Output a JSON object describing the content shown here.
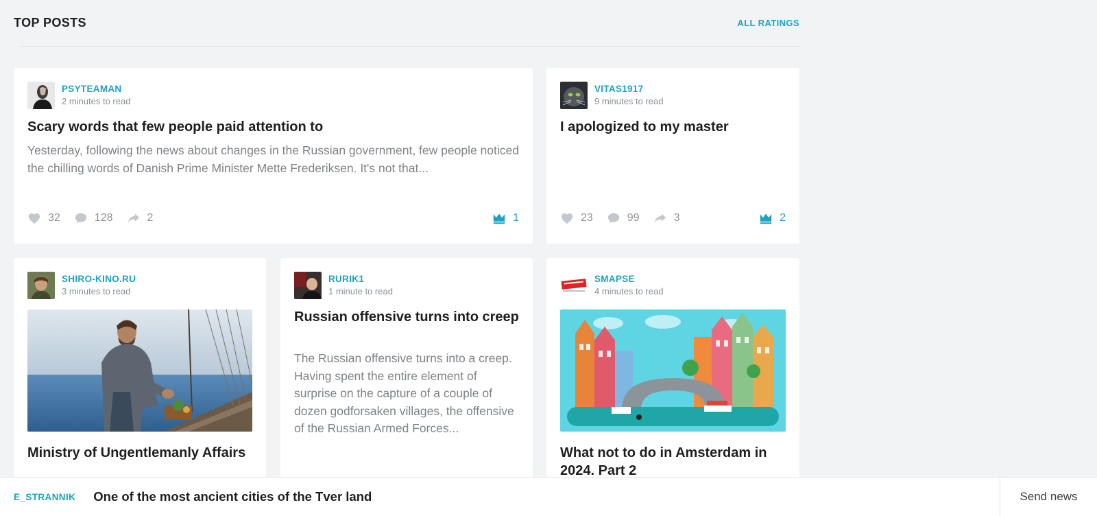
{
  "header": {
    "title": "TOP POSTS",
    "all_ratings": "ALL RATINGS"
  },
  "colors": {
    "accent": "#1aa3c2",
    "muted": "#8e9297",
    "background": "#f2f3f4"
  },
  "posts": [
    {
      "author": "PSYTEAMAN",
      "read_time": "2 minutes to read",
      "title": "Scary words that few people paid attention to",
      "excerpt": "Yesterday, following the news about changes in the Russian government, few people noticed the chilling words of Danish Prime Minister Mette Frederiksen. It's not that...",
      "likes": "32",
      "comments": "128",
      "shares": "2",
      "rating": "1"
    },
    {
      "author": "VITAS1917",
      "read_time": "9 minutes to read",
      "title": "I apologized to my master",
      "likes": "23",
      "comments": "99",
      "shares": "3",
      "rating": "2"
    },
    {
      "author": "SHIRO-KINO.RU",
      "read_time": "3 minutes to read",
      "title": "Ministry of Ungentlemanly Affairs"
    },
    {
      "author": "RURIK1",
      "read_time": "1 minute to read",
      "title": "Russian offensive turns into creep",
      "excerpt": "The Russian offensive turns into a creep. Having spent the entire element of surprise on the capture of a couple of dozen godforsaken villages, the offensive of the Russian Armed Forces..."
    },
    {
      "author": "SMAPSE",
      "read_time": "4 minutes to read",
      "title": "What not to do in Amsterdam in 2024. Part 2"
    }
  ],
  "bottom_bar": {
    "source": "E_STRANNIK",
    "headline": "One of the most ancient cities of the Tver land",
    "send_news": "Send news"
  },
  "icons": {
    "like": "heart-icon",
    "comment": "comment-icon",
    "share": "share-icon",
    "rating": "crown-icon"
  }
}
